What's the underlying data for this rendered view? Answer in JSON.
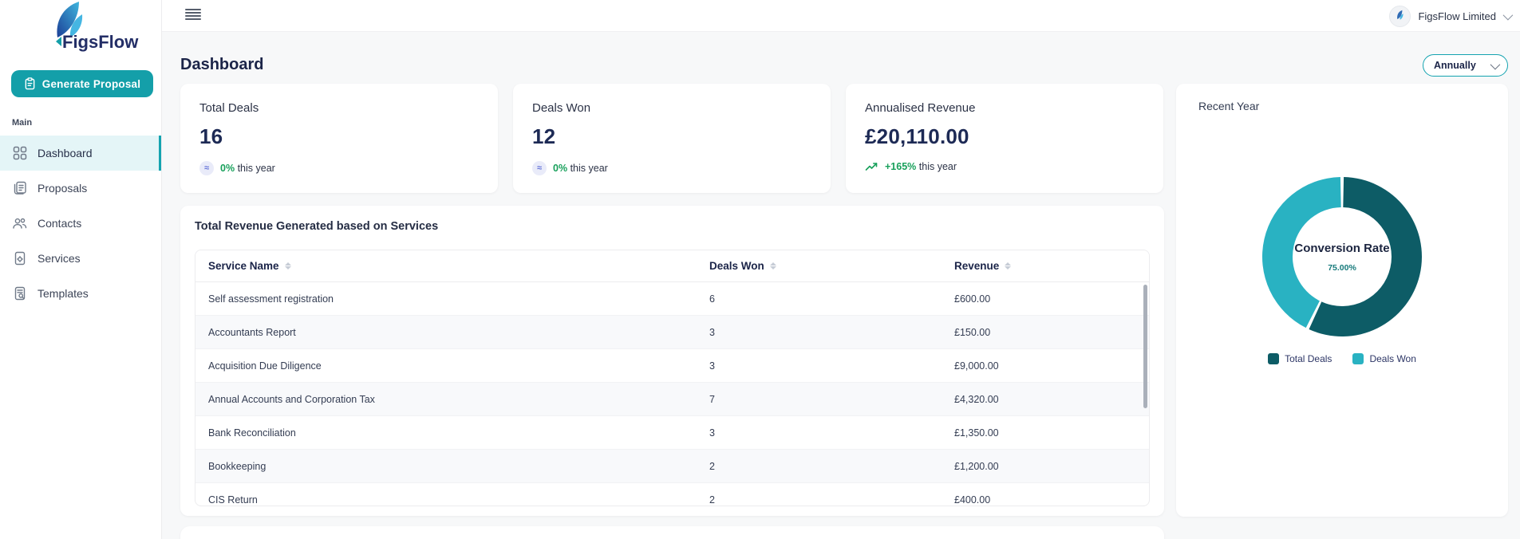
{
  "brand": {
    "name": "FigsFlow"
  },
  "topbar": {
    "company_menu_label": "FigsFlow Limited"
  },
  "sidebar": {
    "generate_button_label": "Generate Proposal",
    "section_label": "Main",
    "items": [
      {
        "label": "Dashboard",
        "icon": "grid-icon",
        "active": true
      },
      {
        "label": "Proposals",
        "icon": "proposal-document-icon",
        "active": false
      },
      {
        "label": "Contacts",
        "icon": "people-icon",
        "active": false
      },
      {
        "label": "Services",
        "icon": "service-document-icon",
        "active": false
      },
      {
        "label": "Templates",
        "icon": "template-search-icon",
        "active": false
      }
    ]
  },
  "page": {
    "title": "Dashboard",
    "period_filter_value": "Annually"
  },
  "stat_cards": [
    {
      "title": "Total Deals",
      "value": "16",
      "change": "0%",
      "change_suffix": "this year",
      "trend": "flat"
    },
    {
      "title": "Deals Won",
      "value": "12",
      "change": "0%",
      "change_suffix": "this year",
      "trend": "flat"
    },
    {
      "title": "Annualised Revenue",
      "value": "£20,110.00",
      "change": "+165%",
      "change_suffix": "this year",
      "trend": "up"
    }
  ],
  "services_table": {
    "title": "Total Revenue Generated based on Services",
    "columns": [
      "Service Name",
      "Deals Won",
      "Revenue"
    ],
    "rows": [
      {
        "service": "Self assessment registration",
        "deals_won": "6",
        "revenue": "£600.00"
      },
      {
        "service": "Accountants Report",
        "deals_won": "3",
        "revenue": "£150.00"
      },
      {
        "service": "Acquisition Due Diligence",
        "deals_won": "3",
        "revenue": "£9,000.00"
      },
      {
        "service": "Annual Accounts and Corporation Tax",
        "deals_won": "7",
        "revenue": "£4,320.00"
      },
      {
        "service": "Bank Reconciliation",
        "deals_won": "3",
        "revenue": "£1,350.00"
      },
      {
        "service": "Bookkeeping",
        "deals_won": "2",
        "revenue": "£1,200.00"
      },
      {
        "service": "CIS Return",
        "deals_won": "2",
        "revenue": "£400.00"
      }
    ]
  },
  "chart_data": {
    "type": "pie",
    "variant": "donut",
    "card_title": "Recent Year",
    "center_label": "Conversion Rate",
    "center_value": "75.00%",
    "series": [
      {
        "name": "Total Deals",
        "value": 16,
        "color": "#0d5c66"
      },
      {
        "name": "Deals Won",
        "value": 12,
        "color": "#29b2c2"
      }
    ],
    "legend_position": "bottom"
  },
  "colors": {
    "accent_teal": "#149fa9",
    "active_nav_bg": "#e4f5f7",
    "positive_green": "#18a05b",
    "navy_text": "#1c2540",
    "donut_dark": "#0d5c66",
    "donut_teal": "#29b2c2",
    "page_bg": "#f7f8f9"
  }
}
